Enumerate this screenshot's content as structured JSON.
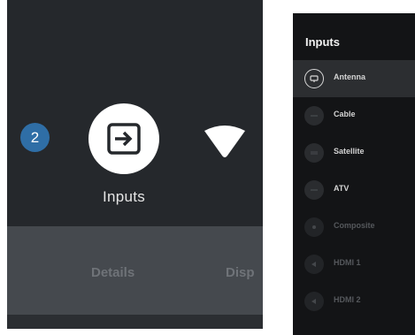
{
  "left": {
    "badge_count": "2",
    "inputs_label": "Inputs",
    "tabs": [
      "Details",
      "Disp"
    ],
    "icons": {
      "inputs": "input-source-icon",
      "network": "wifi-icon"
    }
  },
  "right": {
    "title": "Inputs",
    "items": [
      {
        "label": "Antenna",
        "icon": "antenna-icon",
        "selected": true
      },
      {
        "label": "Cable",
        "icon": "cable-icon"
      },
      {
        "label": "Satellite",
        "icon": "satellite-icon"
      },
      {
        "label": "ATV",
        "icon": "atv-icon"
      },
      {
        "label": "Composite",
        "icon": "composite-icon",
        "dim": true
      },
      {
        "label": "HDMI 1",
        "icon": "hdmi-icon",
        "dim": true
      },
      {
        "label": "HDMI 2",
        "icon": "hdmi-icon",
        "dim": true
      }
    ]
  }
}
